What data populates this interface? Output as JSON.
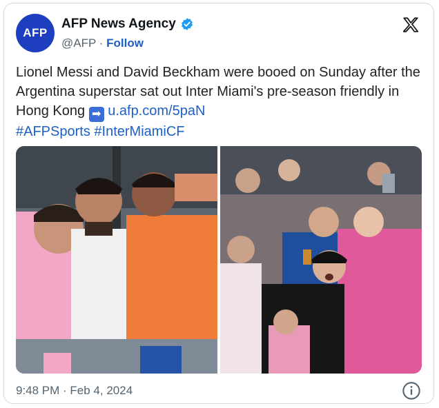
{
  "author": {
    "avatar_text": "AFP",
    "name": "AFP News Agency",
    "handle": "@AFP",
    "separator": " · ",
    "follow_label": "Follow"
  },
  "post": {
    "text_main": "Lionel Messi and David Beckham were booed on Sunday after the Argentina superstar sat out Inter Miami's pre-season friendly in Hong Kong ",
    "arrow_icon": "➡",
    "link": "u.afp.com/5paN",
    "hashtag_1": "#AFPSports",
    "hashtag_2": "#InterMiamiCF"
  },
  "media": {
    "left_photo": "photo-players-bench",
    "right_photo": "photo-fans-booing"
  },
  "footer": {
    "timestamp": "9:48 PM · Feb 4, 2024"
  },
  "icons": {
    "verified": "verified-badge-icon",
    "platform": "x-logo-icon",
    "info": "info-icon"
  },
  "colors": {
    "avatar_bg": "#1d3fbf",
    "link": "#1d5fc7",
    "verified": "#1d9bf0",
    "muted": "#536471"
  }
}
